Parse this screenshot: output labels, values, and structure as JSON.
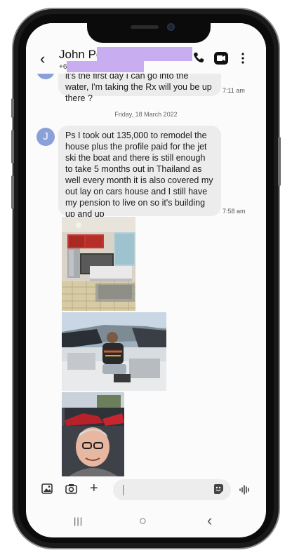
{
  "header": {
    "contact_name": "John Pe",
    "phone_prefix": "+61",
    "back_icon": "chevron-left-icon",
    "call_icon": "phone-icon",
    "video_icon": "video-icon",
    "menu_icon": "more-vertical-icon"
  },
  "conversation": {
    "first_message": {
      "text": "it's the first day I can go into the water, I'm taking the Rx will you be up there ?",
      "time": "7:11 am"
    },
    "date_separator": "Friday, 18 March 2022",
    "avatar_letter": "J",
    "second_message": {
      "text": "Ps I took out 135,000 to remodel the house plus the profile paid for the jet ski the boat and there is still enough to take 5 months out in Thailand as well every month it is also covered my out lay on cars house and I still have my pension to live on so it's building up and up",
      "time": "7:58 am"
    }
  },
  "composer": {
    "gallery_icon": "image-icon",
    "camera_icon": "camera-icon",
    "add_icon": "plus-icon",
    "sticker_icon": "sticker-icon",
    "voice_icon": "voice-wave-icon"
  },
  "navigation": {
    "recents": "|||",
    "home": "○",
    "back": "‹"
  }
}
